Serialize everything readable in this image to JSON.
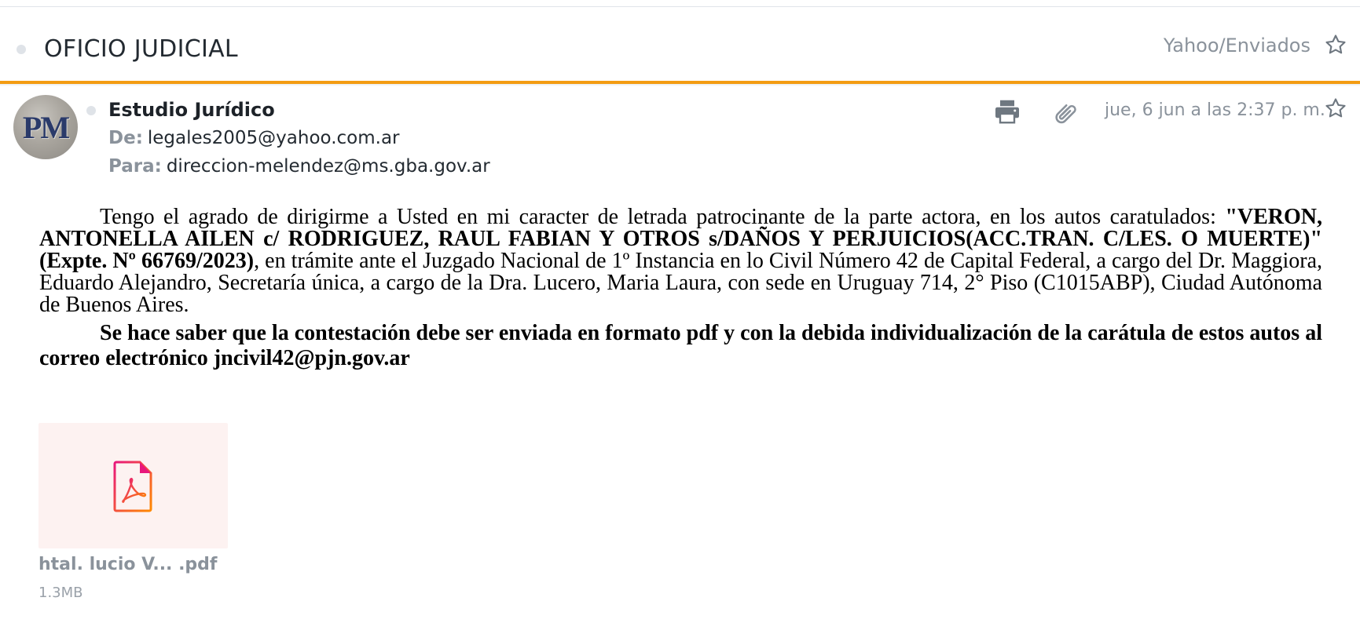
{
  "subject": "OFICIO JUDICIAL",
  "folder": "Yahoo/Enviados",
  "message": {
    "sender_name": "Estudio Jurídico",
    "avatar_initials": "PM",
    "from_label": "De:",
    "from_email": "legales2005@yahoo.com.ar",
    "to_label": "Para:",
    "to_email": "direccion-melendez@ms.gba.gov.ar",
    "date": "jue, 6 jun a las 2:37 p. m."
  },
  "body": {
    "p1_intro": "Tengo el agrado de dirigirme a Usted en mi caracter de letrada patrocinante de la parte actora, en los autos caratulados:",
    "p1_caption": "\"VERON, ANTONELLA AILEN c/ RODRIGUEZ, RAUL FABIAN Y OTROS s/DAÑOS Y PERJUICIOS(ACC.TRAN. C/LES. O MUERTE)\" (Expte. Nº 66769/2023)",
    "p1_rest": ", en trámite ante el Juzgado Nacional de 1º Instancia en lo Civil Número 42 de Capital Federal, a  cargo del Dr. Maggiora, Eduardo Alejandro, Secretaría única, a cargo de la Dra. Lucero, Maria Laura, con sede en Uruguay 714, 2° Piso (C1015ABP), Ciudad Autónoma de Buenos Aires.",
    "p2": "Se hace saber que la contestación debe ser enviada en formato pdf y con la debida individualización de la carátula de estos autos al correo electrónico jncivil42@pjn.gov.ar"
  },
  "attachment": {
    "name": "htal. lucio V...  .pdf",
    "size": "1.3MB",
    "icon": "pdf-file-icon"
  },
  "colors": {
    "accent_orange": "#f39c12",
    "muted_text": "#8a929b",
    "pdf_pink": "#e8177c",
    "pdf_orange": "#ff8a00"
  }
}
